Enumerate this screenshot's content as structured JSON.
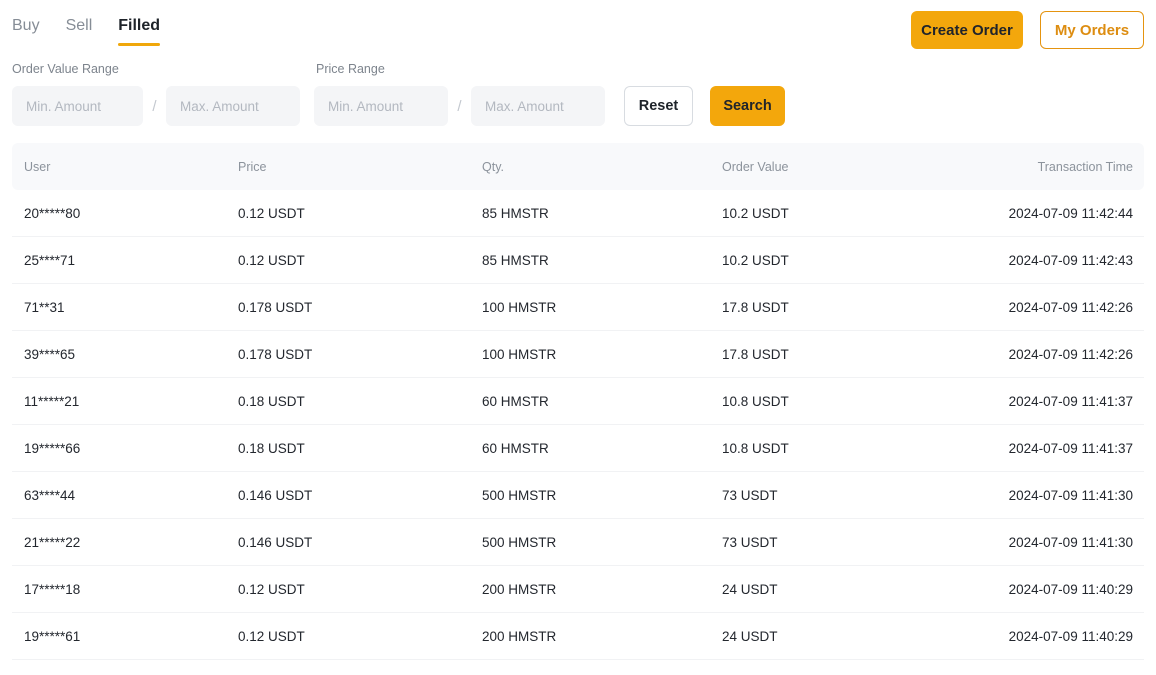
{
  "tabs": [
    {
      "label": "Buy",
      "active": false
    },
    {
      "label": "Sell",
      "active": false
    },
    {
      "label": "Filled",
      "active": true
    }
  ],
  "actions": {
    "create_order": "Create Order",
    "my_orders": "My Orders"
  },
  "filters": {
    "order_value_label": "Order Value Range",
    "price_label": "Price Range",
    "order_value_min_placeholder": "Min. Amount",
    "order_value_max_placeholder": "Max. Amount",
    "price_min_placeholder": "Min. Amount",
    "price_max_placeholder": "Max. Amount",
    "order_value_min_value": "",
    "order_value_max_value": "",
    "price_min_value": "",
    "price_max_value": "",
    "separator": "/",
    "reset": "Reset",
    "search": "Search"
  },
  "table": {
    "columns": [
      "User",
      "Price",
      "Qty.",
      "Order Value",
      "Transaction Time"
    ],
    "rows": [
      {
        "user": "20*****80",
        "price": "0.12 USDT",
        "qty": "85 HMSTR",
        "value": "10.2 USDT",
        "time": "2024-07-09 11:42:44"
      },
      {
        "user": "25****71",
        "price": "0.12 USDT",
        "qty": "85 HMSTR",
        "value": "10.2 USDT",
        "time": "2024-07-09 11:42:43"
      },
      {
        "user": "71**31",
        "price": "0.178 USDT",
        "qty": "100 HMSTR",
        "value": "17.8 USDT",
        "time": "2024-07-09 11:42:26"
      },
      {
        "user": "39****65",
        "price": "0.178 USDT",
        "qty": "100 HMSTR",
        "value": "17.8 USDT",
        "time": "2024-07-09 11:42:26"
      },
      {
        "user": "11*****21",
        "price": "0.18 USDT",
        "qty": "60 HMSTR",
        "value": "10.8 USDT",
        "time": "2024-07-09 11:41:37"
      },
      {
        "user": "19*****66",
        "price": "0.18 USDT",
        "qty": "60 HMSTR",
        "value": "10.8 USDT",
        "time": "2024-07-09 11:41:37"
      },
      {
        "user": "63****44",
        "price": "0.146 USDT",
        "qty": "500 HMSTR",
        "value": "73 USDT",
        "time": "2024-07-09 11:41:30"
      },
      {
        "user": "21*****22",
        "price": "0.146 USDT",
        "qty": "500 HMSTR",
        "value": "73 USDT",
        "time": "2024-07-09 11:41:30"
      },
      {
        "user": "17*****18",
        "price": "0.12 USDT",
        "qty": "200 HMSTR",
        "value": "24 USDT",
        "time": "2024-07-09 11:40:29"
      },
      {
        "user": "19*****61",
        "price": "0.12 USDT",
        "qty": "200 HMSTR",
        "value": "24 USDT",
        "time": "2024-07-09 11:40:29"
      }
    ]
  },
  "colors": {
    "accent": "#f3a70c",
    "accent_border": "#e5940f",
    "accent_text": "#dd8d11",
    "text_primary": "#1e2329",
    "text_muted": "#868d96",
    "header_bg": "#f8f9fb",
    "field_bg": "#f4f5f7"
  }
}
